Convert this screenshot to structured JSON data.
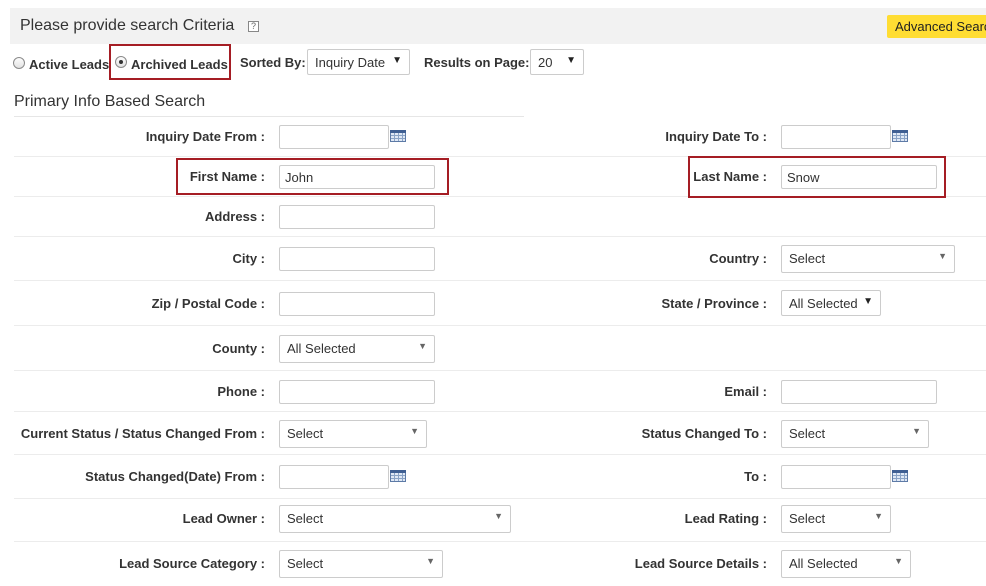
{
  "header": {
    "title": "Please provide search Criteria",
    "help_icon": "?",
    "advanced_search_label": "Advanced Search"
  },
  "options": {
    "active_leads": "Active Leads",
    "archived_leads": "Archived Leads",
    "selected": "archived_leads",
    "sorted_by_label": "Sorted By:",
    "sorted_by_value": "Inquiry Date",
    "results_label": "Results on Page:",
    "results_value": "20"
  },
  "section": {
    "title": "Primary Info Based Search"
  },
  "fields": {
    "inquiry_date_from": {
      "label": "Inquiry Date From :",
      "value": ""
    },
    "inquiry_date_to": {
      "label": "Inquiry Date To :",
      "value": ""
    },
    "first_name": {
      "label": "First Name :",
      "value": "John"
    },
    "last_name": {
      "label": "Last Name :",
      "value": "Snow"
    },
    "address": {
      "label": "Address :",
      "value": ""
    },
    "city": {
      "label": "City :",
      "value": ""
    },
    "country": {
      "label": "Country :",
      "value": "Select"
    },
    "zip": {
      "label": "Zip / Postal Code :",
      "value": ""
    },
    "state": {
      "label": "State / Province :",
      "value": "All Selected"
    },
    "county": {
      "label": "County :",
      "value": "All Selected"
    },
    "phone": {
      "label": "Phone :",
      "value": ""
    },
    "email": {
      "label": "Email :",
      "value": ""
    },
    "current_status": {
      "label": "Current Status / Status Changed From :",
      "value": "Select"
    },
    "status_changed_to": {
      "label": "Status Changed To :",
      "value": "Select"
    },
    "status_date_from": {
      "label": "Status Changed(Date) From :",
      "value": ""
    },
    "status_date_to": {
      "label": "To :",
      "value": ""
    },
    "lead_owner": {
      "label": "Lead Owner :",
      "value": "Select"
    },
    "lead_rating": {
      "label": "Lead Rating :",
      "value": "Select"
    },
    "lead_source_category": {
      "label": "Lead Source Category :",
      "value": "Select"
    },
    "lead_source_details": {
      "label": "Lead Source Details :",
      "value": "All Selected"
    }
  },
  "icons": {
    "caret": "▼",
    "calendar": "calendar-icon"
  },
  "colors": {
    "highlight": "#a51d24",
    "advanced_button": "#ffdd33",
    "header_bg": "#f2f2f2"
  }
}
